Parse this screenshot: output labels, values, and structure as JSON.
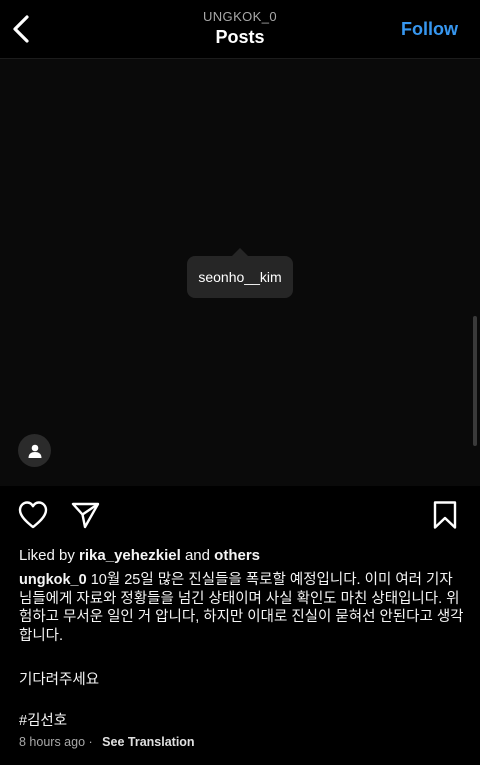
{
  "header": {
    "username": "UNGKOK_0",
    "title": "Posts",
    "follow_label": "Follow"
  },
  "media": {
    "tag_username": "seonho__kim"
  },
  "likes": {
    "prefix": "Liked by",
    "user": "rika_yehezkiel",
    "conj": "and",
    "others": "others"
  },
  "caption": {
    "username": "ungkok_0",
    "text": "10월 25일 많은 진실들을 폭로할 예정입니다. 이미 여러 기자님들에게 자료와 정황들을 넘긴 상태이며 사실 확인도 마친 상태입니다. 위험하고 무서운 일인 거 압니다, 하지만 이대로 진실이 묻혀선 안된다고 생각합니다.",
    "line2": "기다려주세요",
    "hashtag": "#김선호"
  },
  "meta": {
    "time": "8 hours ago",
    "separator": "·",
    "translation": "See Translation"
  },
  "colors": {
    "background": "#000000",
    "accent": "#3797f0",
    "muted": "#a8a8a8"
  },
  "icons": [
    "back-arrow-icon",
    "user-tag-icon",
    "heart-icon",
    "share-icon",
    "bookmark-icon"
  ]
}
